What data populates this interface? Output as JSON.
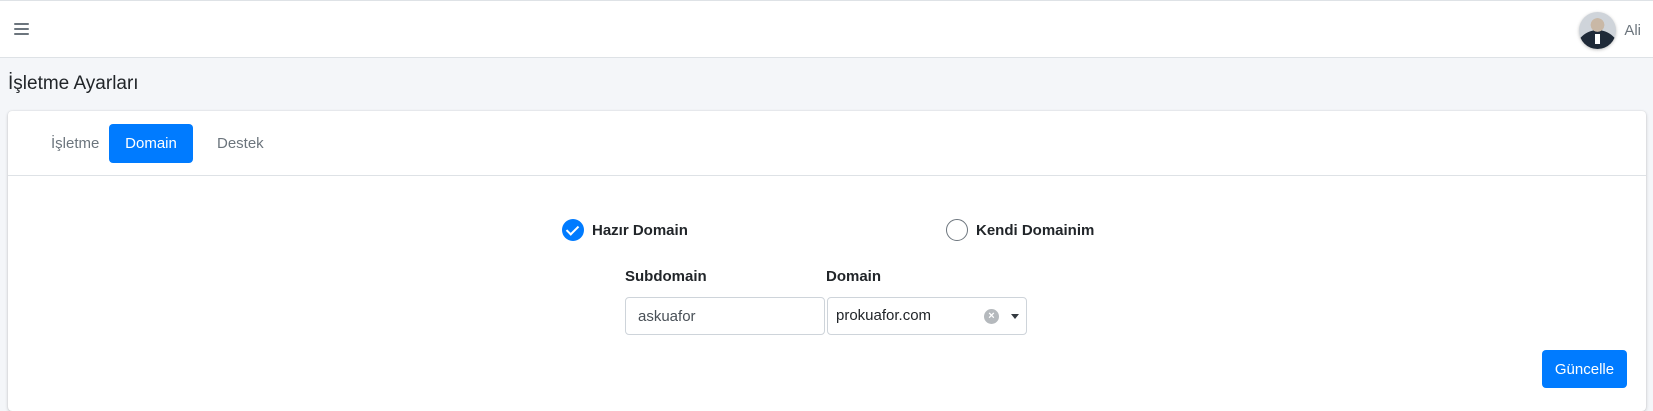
{
  "header": {
    "menu_icon": "hamburger-icon",
    "user_name": "Ali",
    "avatar": "user-avatar"
  },
  "page": {
    "title": "İşletme Ayarları"
  },
  "tabs": [
    {
      "label": "İşletme",
      "active": false
    },
    {
      "label": "Domain",
      "active": true
    },
    {
      "label": "Destek",
      "active": false
    }
  ],
  "domain_form": {
    "options": [
      {
        "label": "Hazır Domain",
        "checked": true
      },
      {
        "label": "Kendi Domainim",
        "checked": false
      }
    ],
    "subdomain_label": "Subdomain",
    "subdomain_value": "askuafor",
    "domain_label": "Domain",
    "domain_value": "prokuafor.com",
    "submit_label": "Güncelle"
  },
  "colors": {
    "primary": "#007bff",
    "background": "#f4f6f9",
    "muted_text": "#6c757d"
  }
}
